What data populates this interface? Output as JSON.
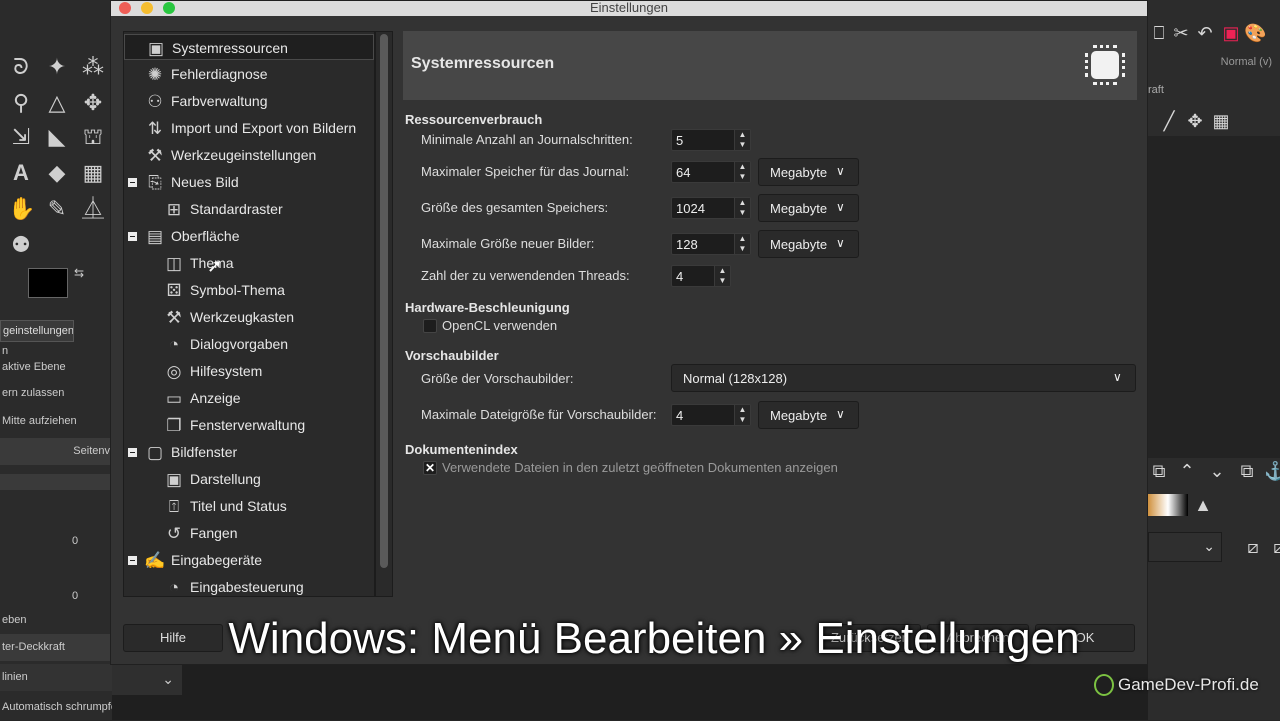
{
  "window": {
    "title": "Einstellungen"
  },
  "tree": {
    "items": [
      {
        "label": "Systemressourcen",
        "icon": "chip-icon"
      },
      {
        "label": "Fehlerdiagnose",
        "icon": "bug-icon"
      },
      {
        "label": "Farbverwaltung",
        "icon": "color-circles-icon"
      },
      {
        "label": "Import und Export von Bildern",
        "icon": "import-export-icon"
      },
      {
        "label": "Werkzeugeinstellungen",
        "icon": "tool-options-icon"
      },
      {
        "label": "Neues Bild",
        "icon": "new-image-icon"
      },
      {
        "label": "Standardraster",
        "icon": "grid-icon"
      },
      {
        "label": "Oberfläche",
        "icon": "interface-icon"
      },
      {
        "label": "Thema",
        "icon": "theme-icon"
      },
      {
        "label": "Symbol-Thema",
        "icon": "icon-theme-icon"
      },
      {
        "label": "Werkzeugkasten",
        "icon": "toolbox-icon"
      },
      {
        "label": "Dialogvorgaben",
        "icon": "dialog-defaults-icon"
      },
      {
        "label": "Hilfesystem",
        "icon": "help-ring-icon"
      },
      {
        "label": "Anzeige",
        "icon": "display-icon"
      },
      {
        "label": "Fensterverwaltung",
        "icon": "windows-icon"
      },
      {
        "label": "Bildfenster",
        "icon": "image-window-icon"
      },
      {
        "label": "Darstellung",
        "icon": "appearance-icon"
      },
      {
        "label": "Titel und Status",
        "icon": "title-status-icon"
      },
      {
        "label": "Fangen",
        "icon": "snap-icon"
      },
      {
        "label": "Eingabegeräte",
        "icon": "input-devices-icon"
      },
      {
        "label": "Eingabesteuerung",
        "icon": "input-controllers-icon"
      }
    ]
  },
  "page": {
    "title": "Systemressourcen",
    "sections": {
      "resources": "Ressourcenverbrauch",
      "hardware": "Hardware-Beschleunigung",
      "thumbnails": "Vorschaubilder",
      "docindex": "Dokumentenindex"
    },
    "fields": {
      "undo_levels_label": "Minimale Anzahl an Journalschritten:",
      "undo_levels_value": "5",
      "undo_memory_label": "Maximaler Speicher für das Journal:",
      "undo_memory_value": "64",
      "tile_cache_label": "Größe des gesamten Speichers:",
      "tile_cache_value": "1024",
      "max_image_label": "Maximale Größe neuer Bilder:",
      "max_image_value": "128",
      "threads_label": "Zahl der zu verwendenden Threads:",
      "threads_value": "4",
      "unit": "Megabyte",
      "opencl_label": "OpenCL verwenden",
      "thumb_size_label": "Größe der Vorschaubilder:",
      "thumb_size_value": "Normal (128x128)",
      "thumb_filesize_label": "Maximale Dateigröße für Vorschaubilder:",
      "thumb_filesize_value": "4",
      "recent_docs_label": "Verwendete Dateien in den zuletzt geöffneten Dokumenten anzeigen"
    }
  },
  "buttons": {
    "help": "Hilfe",
    "reset": "Zurücksetzen",
    "cancel": "Abbrechen",
    "ok": "OK"
  },
  "overlay": {
    "caption": "Windows: Menü Bearbeiten » Einstellungen",
    "watermark": "GameDev-Profi.de"
  },
  "background": {
    "left_panel": {
      "tab": "geinstellungen",
      "rows": [
        "n",
        "aktive Ebene",
        "ern zulassen",
        "Mitte aufziehen",
        "Seitenv",
        "0",
        "0",
        "eben",
        "ter-Deckkraft",
        "linien",
        "Automatisch schrumpfen"
      ]
    },
    "right_panel": {
      "mode": "Normal (v)",
      "lock": "raft"
    }
  },
  "colors": {
    "dialog_bg": "#333333",
    "tree_bg": "#2a2a2a",
    "header_band": "#474747",
    "titlebar": "#dcdcdc",
    "close": "#ee5e56",
    "minimize": "#f5bd2f",
    "maximize": "#29c740"
  }
}
